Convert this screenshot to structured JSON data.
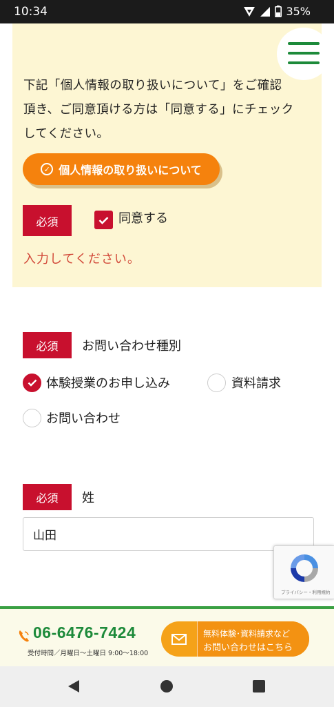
{
  "status_bar": {
    "time": "10:34",
    "battery": "35%"
  },
  "menu": {
    "icon": "hamburger-menu-icon"
  },
  "consent": {
    "text_lines": [
      "下記「個人情報の取り扱いについて」をご確認",
      "頂き、ご同意頂ける方は「同意する」にチェック",
      "してください。"
    ],
    "privacy_button_label": "個人情報の取り扱いについて",
    "required_label": "必須",
    "agree_label": "同意する",
    "agree_checked": true,
    "error_message": "入力してください。"
  },
  "inquiry_type": {
    "required_label": "必須",
    "label": "お問い合わせ種別",
    "options": [
      {
        "label": "体験授業のお申し込み",
        "checked": true
      },
      {
        "label": "資料請求",
        "checked": false
      },
      {
        "label": "お問い合わせ",
        "checked": false
      }
    ]
  },
  "last_name": {
    "required_label": "必須",
    "label": "姓",
    "value": "山田"
  },
  "recaptcha": {
    "text": "プライバシー・利用規約"
  },
  "footer": {
    "phone": "06-6476-7424",
    "hours": "受付時間／月曜日〜土曜日 9:00〜18:00",
    "contact_line1": "無料体験･資料請求など",
    "contact_line2": "お問い合わせはこちら"
  },
  "colors": {
    "required_badge": "#c8102e",
    "accent_orange": "#f5820d",
    "brand_green": "#1d8a3a",
    "consent_bg": "#fdf6d3",
    "error_text": "#d24a3a"
  }
}
